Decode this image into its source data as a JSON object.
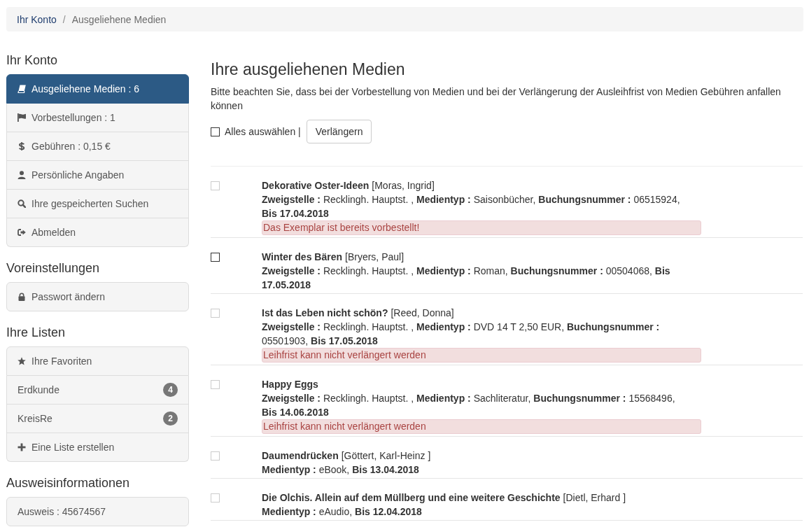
{
  "breadcrumb": {
    "separator": "/",
    "items": [
      {
        "label": "Ihr Konto",
        "current": false
      },
      {
        "label": "Ausgeliehene Medien",
        "current": true
      }
    ]
  },
  "sidebar": {
    "sections": [
      {
        "heading": "Ihr Konto",
        "items": [
          {
            "kind": "link",
            "label": "Ausgeliehene Medien : 6",
            "selected": true
          },
          {
            "kind": "link",
            "label": "Vorbestellungen : 1",
            "selected": false
          },
          {
            "kind": "link",
            "label": "Gebühren : 0,15 €",
            "selected": false
          },
          {
            "kind": "link",
            "label": "Persönliche Angaben",
            "selected": false
          },
          {
            "kind": "link",
            "label": "Ihre gespeicherten Suchen",
            "selected": false
          },
          {
            "kind": "link",
            "label": "Abmelden",
            "selected": false
          }
        ]
      },
      {
        "heading": "Voreinstellungen",
        "items": [
          {
            "kind": "link",
            "label": "Passwort ändern",
            "selected": false
          }
        ]
      },
      {
        "heading": "Ihre Listen",
        "items": [
          {
            "kind": "link",
            "label": "Ihre Favoriten",
            "selected": false
          },
          {
            "kind": "link",
            "label": "Erdkunde",
            "badge": "4",
            "selected": false
          },
          {
            "kind": "link",
            "label": "KreisRe",
            "badge": "2",
            "selected": false
          },
          {
            "kind": "link",
            "label": "Eine Liste erstellen",
            "selected": false
          }
        ]
      },
      {
        "heading": "Ausweisinformationen",
        "items": [
          {
            "kind": "info",
            "label": "Ausweis : 45674567"
          }
        ]
      }
    ]
  },
  "main": {
    "title": "Ihre ausgeliehenen Medien",
    "note": "Bitte beachten Sie, dass bei der Vorbestellung von Medien und bei der Verlängerung der Ausleihfrist von Medien Gebühren anfallen können",
    "select_all": {
      "label": "Alles auswählen |",
      "checked": false
    },
    "renew_button": "Verlängern",
    "items": [
      {
        "checked": false,
        "disabled": true,
        "title": "Dekorative Oster-Ideen",
        "author": "[Moras, Ingrid]",
        "details": "**Zweigstelle :** Recklingh. Hauptst. , **Medientyp :** Saisonbücher, **Buchungsnummer :** 06515924, **Bis 17.04.2018**",
        "alert": "Das Exemplar ist bereits vorbestellt!"
      },
      {
        "checked": false,
        "disabled": false,
        "title": "Winter des Bären",
        "author": "[Bryers, Paul]",
        "details": "**Zweigstelle :** Recklingh. Hauptst. , **Medientyp :** Roman, **Buchungsnummer :** 00504068, **Bis 17.05.2018**"
      },
      {
        "checked": false,
        "disabled": true,
        "title": "Ist das Leben nicht schön?",
        "author": "[Reed, Donna]",
        "details": "**Zweigstelle :** Recklingh. Hauptst. , **Medientyp :** DVD 14 T 2,50 EUR, **Buchungsnummer :** 05501903, **Bis 17.05.2018**",
        "alert": "Leihfrist kann nicht verlängert werden"
      },
      {
        "checked": false,
        "disabled": true,
        "title": "Happy Eggs",
        "details": "**Zweigstelle :** Recklingh. Hauptst. , **Medientyp :** Sachliteratur, **Buchungsnummer :** 15568496, **Bis 14.06.2018**",
        "alert": "Leihfrist kann nicht verlängert werden"
      },
      {
        "checked": false,
        "disabled": true,
        "title": "Daumendrücken",
        "author": "[Göttert, Karl-Heinz ]",
        "details": "**Medientyp :** eBook, **Bis 13.04.2018**"
      },
      {
        "checked": false,
        "disabled": true,
        "title": "Die Olchis. Allein auf dem Müllberg und eine weitere Geschichte",
        "author": "[Dietl, Erhard ]",
        "details": "**Medientyp :** eAudio, **Bis 12.04.2018**"
      }
    ]
  }
}
